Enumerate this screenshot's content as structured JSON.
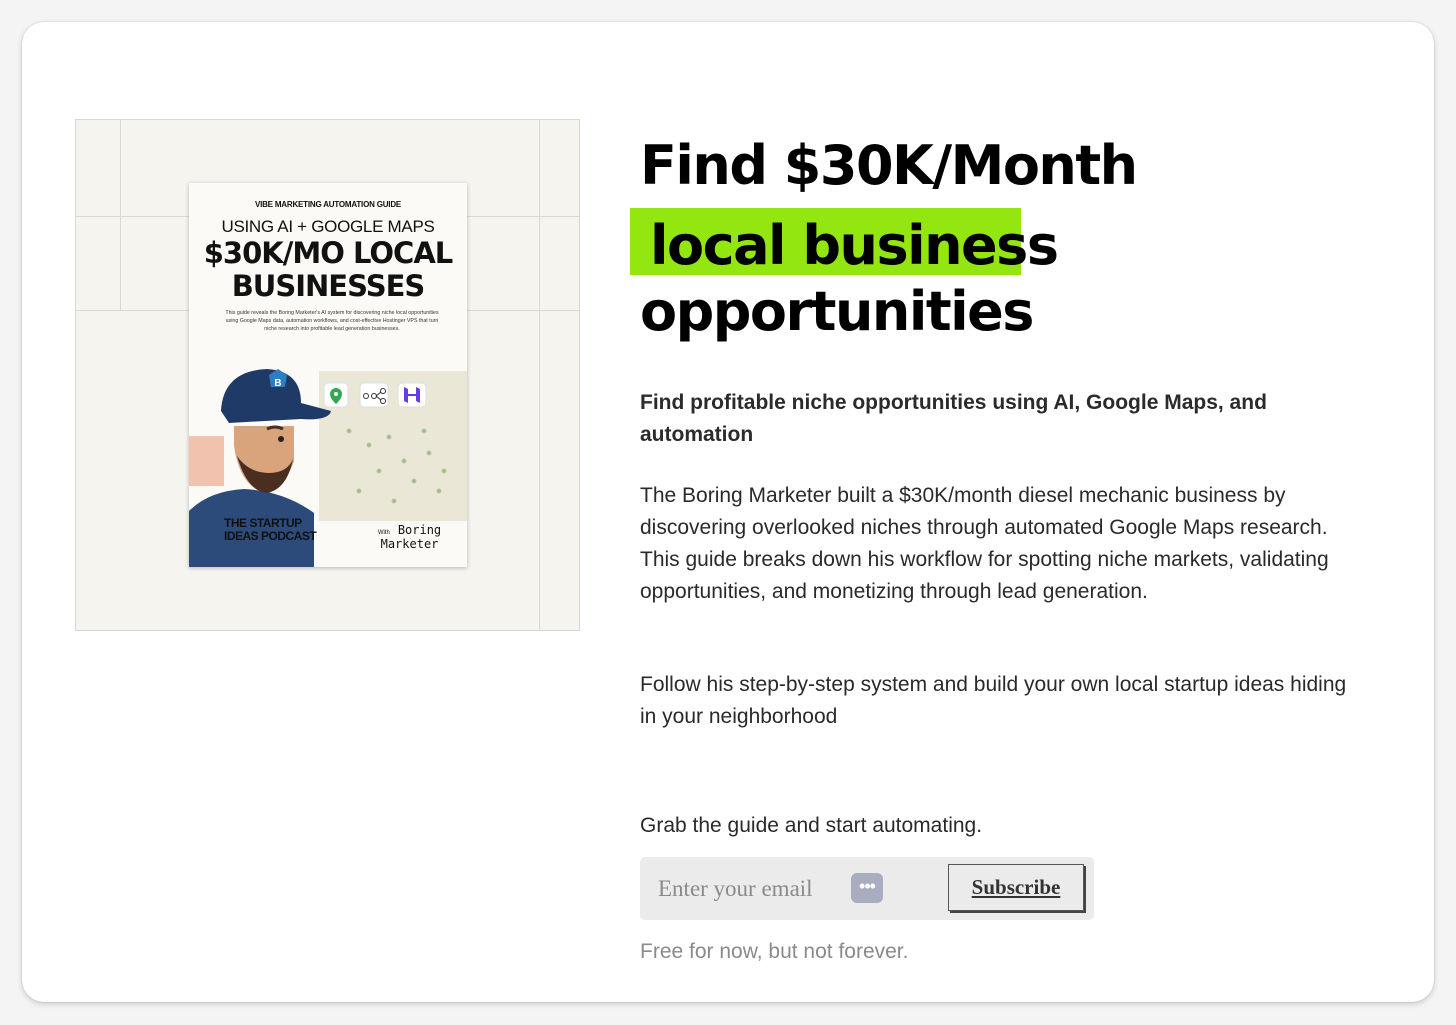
{
  "colors": {
    "highlight": "#93e60f",
    "page_background": "#f4f4f4",
    "card_background": "#ffffff",
    "cover_background": "#f6f4ef"
  },
  "cover": {
    "eyebrow": "VIBE MARKETING AUTOMATION GUIDE",
    "subtitle": "USING AI + GOOGLE MAPS",
    "title_line1": "$30K/MO LOCAL",
    "title_line2": "BUSINESSES",
    "description": "This guide reveals the Boring Marketer's AI system for discovering niche local opportunities using Google Maps data, automation workflows, and cost-effective Hostinger VPS that turn niche research into profitable lead generation businesses.",
    "podcast_line1": "THE STARTUP",
    "podcast_line2": "IDEAS PODCAST",
    "with_label": "With",
    "author": "Boring Marketer",
    "icons": [
      "cap-logo-icon",
      "google-maps-pin-icon",
      "workflow-nodes-icon",
      "hostinger-logo-icon"
    ]
  },
  "headline": {
    "line1": "Find $30K/Month",
    "line2": "local business",
    "line3": "opportunities"
  },
  "lead": "Find profitable niche opportunities using AI, Google Maps, and automation",
  "body1": "The Boring Marketer built a $30K/month diesel mechanic business by discovering overlooked niches through automated Google Maps research. This guide breaks down his workflow for spotting niche markets, validating opportunities, and monetizing through lead generation.",
  "body2": "Follow his step-by-step system and build your own local startup ideas hiding in your neighborhood",
  "cta": "Grab the guide and start automating.",
  "form": {
    "email_placeholder": "Enter your email",
    "email_value": "",
    "dots_icon_glyph": "•••",
    "subscribe_label": "Subscribe"
  },
  "fine_print": "Free for now, but not forever."
}
